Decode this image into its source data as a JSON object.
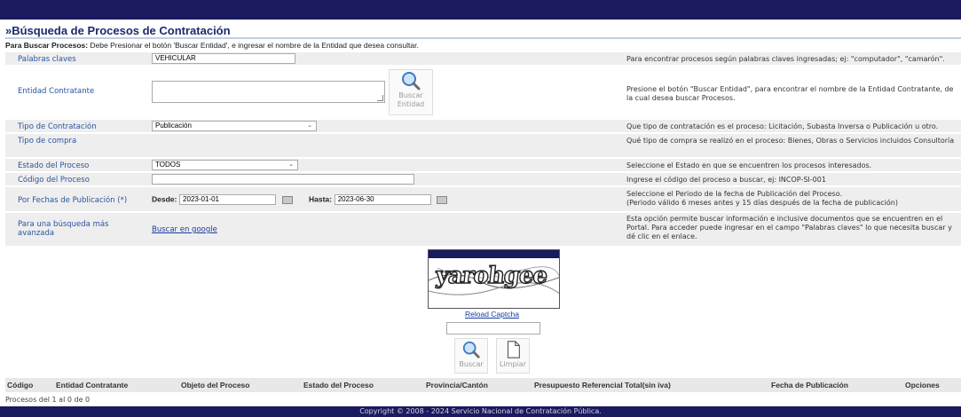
{
  "page": {
    "title": "»Búsqueda de Procesos de Contratación",
    "instructions_bold": "Para Buscar Procesos:",
    "instructions_rest": " Debe Presionar el botón 'Buscar Entidad', e ingresar el nombre de la Entidad que desea consultar."
  },
  "form": {
    "palabras": {
      "label": "Palabras claves",
      "value": "VEHICULAR",
      "help": "Para encontrar procesos según palabras claves ingresadas; ej: \"computador\", \"camarón\"."
    },
    "entidad": {
      "label": "Entidad Contratante",
      "value": "",
      "button_line1": "Buscar",
      "button_line2": "Entidad",
      "help": "Presione el botón \"Buscar Entidad\", para encontrar el nombre de la Entidad Contratante, de la cual desea buscar Procesos."
    },
    "tipo_contratacion": {
      "label": "Tipo de Contratación",
      "value": "Publicación",
      "help": "Que tipo de contratación es el proceso: Licitación, Subasta Inversa o Publicación u otro."
    },
    "tipo_compra": {
      "label": "Tipo de compra",
      "help": "Qué tipo de compra se realizó en el proceso: Bienes, Obras o Servicios incluidos Consultoría"
    },
    "estado": {
      "label": "Estado del Proceso",
      "value": "TODOS",
      "help": "Seleccione el Estado en que se encuentren los procesos interesados."
    },
    "codigo": {
      "label": "Código del Proceso",
      "value": "",
      "help": "Ingrese el código del proceso a buscar, ej: INCOP-SI-001"
    },
    "fechas": {
      "label": "Por Fechas de Publicación (*)",
      "desde_label": "Desde:",
      "desde_value": "2023-01-01",
      "hasta_label": "Hasta:",
      "hasta_value": "2023-06-30",
      "help_line1": "Seleccione el Periodo de la fecha de Publicación del Proceso.",
      "help_line2": "(Periodo válido 6 meses antes y 15 días después de la fecha de publicación)"
    },
    "avanzada": {
      "label_line1": "Para una búsqueda más",
      "label_line2": "avanzada",
      "link": "Buscar en google",
      "help": "Esta opción permite buscar información e inclusive documentos que se encuentren en el Portal. Para acceder puede ingresar en el campo \"Palabras claves\" lo que necesita buscar y dé clic en el enlace."
    }
  },
  "captcha": {
    "text": "yarohgee",
    "reload": "Reload Captcha",
    "value": ""
  },
  "actions": {
    "buscar": "Buscar",
    "limpiar": "Limpiar"
  },
  "results": {
    "columns": [
      "Código",
      "Entidad Contratante",
      "Objeto del Proceso",
      "Estado del Proceso",
      "Provincia/Cantón",
      "Presupuesto Referencial Total(sin iva)",
      "Fecha de Publicación",
      "Opciones"
    ],
    "count": "Procesos del 1 al 0 de 0"
  },
  "footer": {
    "copyright": "Copyright © 2008 - 2024 Servicio Nacional de Contratación Pública."
  },
  "colors": {
    "header_bar": "#1a1a5e",
    "label_blue": "#2a55a0",
    "row_shade": "#eeeeee"
  }
}
